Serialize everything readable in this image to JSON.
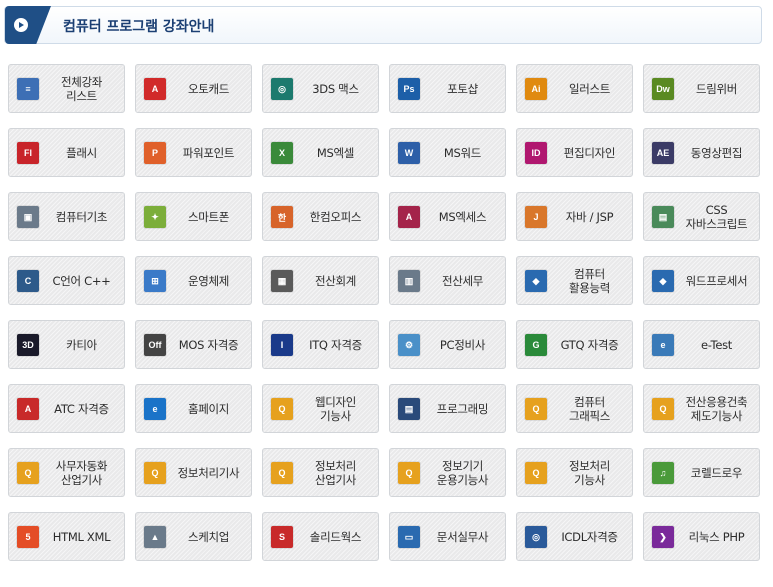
{
  "header": {
    "title": "컴퓨터 프로그램 강좌안내"
  },
  "courses": [
    {
      "label": "전체강좌\n리스트",
      "icon": "list-icon",
      "color": "#3d6fb5",
      "glyph": "≡"
    },
    {
      "label": "오토캐드",
      "icon": "autocad-icon",
      "color": "#d12a2a",
      "glyph": "A"
    },
    {
      "label": "3DS 맥스",
      "icon": "3ds-max-icon",
      "color": "#1c7a6e",
      "glyph": "◎"
    },
    {
      "label": "포토샵",
      "icon": "photoshop-icon",
      "color": "#1d5fa8",
      "glyph": "Ps"
    },
    {
      "label": "일러스트",
      "icon": "illustrator-icon",
      "color": "#e08a10",
      "glyph": "Ai"
    },
    {
      "label": "드림위버",
      "icon": "dreamweaver-icon",
      "color": "#5a8a22",
      "glyph": "Dw"
    },
    {
      "label": "플래시",
      "icon": "flash-icon",
      "color": "#c8242a",
      "glyph": "Fl"
    },
    {
      "label": "파워포인트",
      "icon": "powerpoint-icon",
      "color": "#e0602a",
      "glyph": "P"
    },
    {
      "label": "MS엑셀",
      "icon": "excel-icon",
      "color": "#3a8a3a",
      "glyph": "X"
    },
    {
      "label": "MS워드",
      "icon": "word-icon",
      "color": "#2d5fa8",
      "glyph": "W"
    },
    {
      "label": "편집디자인",
      "icon": "indesign-icon",
      "color": "#b0176f",
      "glyph": "ID"
    },
    {
      "label": "동영상편집",
      "icon": "after-effects-icon",
      "color": "#3b3b66",
      "glyph": "AE"
    },
    {
      "label": "컴퓨터기초",
      "icon": "computer-basics-icon",
      "color": "#6b7a8a",
      "glyph": "▣"
    },
    {
      "label": "스마트폰",
      "icon": "android-icon",
      "color": "#7cae3a",
      "glyph": "✦"
    },
    {
      "label": "한컴오피스",
      "icon": "hancom-office-icon",
      "color": "#d7642a",
      "glyph": "한"
    },
    {
      "label": "MS엑세스",
      "icon": "access-icon",
      "color": "#a4244a",
      "glyph": "A"
    },
    {
      "label": "자바 / JSP",
      "icon": "java-icon",
      "color": "#d9772b",
      "glyph": "J"
    },
    {
      "label": "CSS\n자바스크립트",
      "icon": "css-javascript-icon",
      "color": "#4a8a5a",
      "glyph": "▤"
    },
    {
      "label": "C언어 C++",
      "icon": "c-language-icon",
      "color": "#2d5a8a",
      "glyph": "C"
    },
    {
      "label": "운영체제",
      "icon": "windows-icon",
      "color": "#3a7ac8",
      "glyph": "⊞"
    },
    {
      "label": "전산회계",
      "icon": "accounting-icon",
      "color": "#5a5a5a",
      "glyph": "▦"
    },
    {
      "label": "전산세무",
      "icon": "tax-icon",
      "color": "#6a7a8a",
      "glyph": "▥"
    },
    {
      "label": "컴퓨터\n활용능력",
      "icon": "computer-skills-icon",
      "color": "#2a6ab0",
      "glyph": "◆"
    },
    {
      "label": "워드프로세서",
      "icon": "word-processor-icon",
      "color": "#2a6ab0",
      "glyph": "◆"
    },
    {
      "label": "카티아",
      "icon": "catia-icon",
      "color": "#1a1a2a",
      "glyph": "3D"
    },
    {
      "label": "MOS 자격증",
      "icon": "mos-icon",
      "color": "#444444",
      "glyph": "Off"
    },
    {
      "label": "ITQ 자격증",
      "icon": "itq-icon",
      "color": "#1a3a8a",
      "glyph": "I"
    },
    {
      "label": "PC정비사",
      "icon": "pc-repair-icon",
      "color": "#4a90c8",
      "glyph": "⚙"
    },
    {
      "label": "GTQ 자격증",
      "icon": "gtq-icon",
      "color": "#2a8a3a",
      "glyph": "G"
    },
    {
      "label": "e-Test",
      "icon": "e-test-icon",
      "color": "#3a7ab8",
      "glyph": "e"
    },
    {
      "label": "ATC 자격증",
      "icon": "atc-icon",
      "color": "#c82a2a",
      "glyph": "A"
    },
    {
      "label": "홈페이지",
      "icon": "internet-explorer-icon",
      "color": "#1a73c8",
      "glyph": "e"
    },
    {
      "label": "웹디자인\n기능사",
      "icon": "q-net-icon",
      "color": "#e6a11e",
      "glyph": "Q"
    },
    {
      "label": "프로그래밍",
      "icon": "programming-icon",
      "color": "#2a4a7a",
      "glyph": "▤"
    },
    {
      "label": "컴퓨터\n그래픽스",
      "icon": "q-net-icon",
      "color": "#e6a11e",
      "glyph": "Q"
    },
    {
      "label": "전산응용건축\n제도기능사",
      "icon": "q-net-icon",
      "color": "#e6a11e",
      "glyph": "Q"
    },
    {
      "label": "사무자동화\n산업기사",
      "icon": "q-net-icon",
      "color": "#e6a11e",
      "glyph": "Q"
    },
    {
      "label": "정보처리기사",
      "icon": "q-net-icon",
      "color": "#e6a11e",
      "glyph": "Q"
    },
    {
      "label": "정보처리\n산업기사",
      "icon": "q-net-icon",
      "color": "#e6a11e",
      "glyph": "Q"
    },
    {
      "label": "정보기기\n운용기능사",
      "icon": "q-net-icon",
      "color": "#e6a11e",
      "glyph": "Q"
    },
    {
      "label": "정보처리\n기능사",
      "icon": "q-net-icon",
      "color": "#e6a11e",
      "glyph": "Q"
    },
    {
      "label": "코렐드로우",
      "icon": "coreldraw-icon",
      "color": "#4a9a3a",
      "glyph": "♫"
    },
    {
      "label": "HTML XML",
      "icon": "html5-icon",
      "color": "#e44d26",
      "glyph": "5"
    },
    {
      "label": "스케치업",
      "icon": "sketchup-icon",
      "color": "#6a7a8a",
      "glyph": "▲"
    },
    {
      "label": "솔리드웍스",
      "icon": "solidworks-icon",
      "color": "#c82a2a",
      "glyph": "S"
    },
    {
      "label": "문서실무사",
      "icon": "document-icon",
      "color": "#2a6ab0",
      "glyph": "▭"
    },
    {
      "label": "ICDL자격증",
      "icon": "icdl-icon",
      "color": "#2a5a9a",
      "glyph": "◎"
    },
    {
      "label": "리눅스 PHP",
      "icon": "linux-php-icon",
      "color": "#7a2a9a",
      "glyph": "❯"
    }
  ]
}
